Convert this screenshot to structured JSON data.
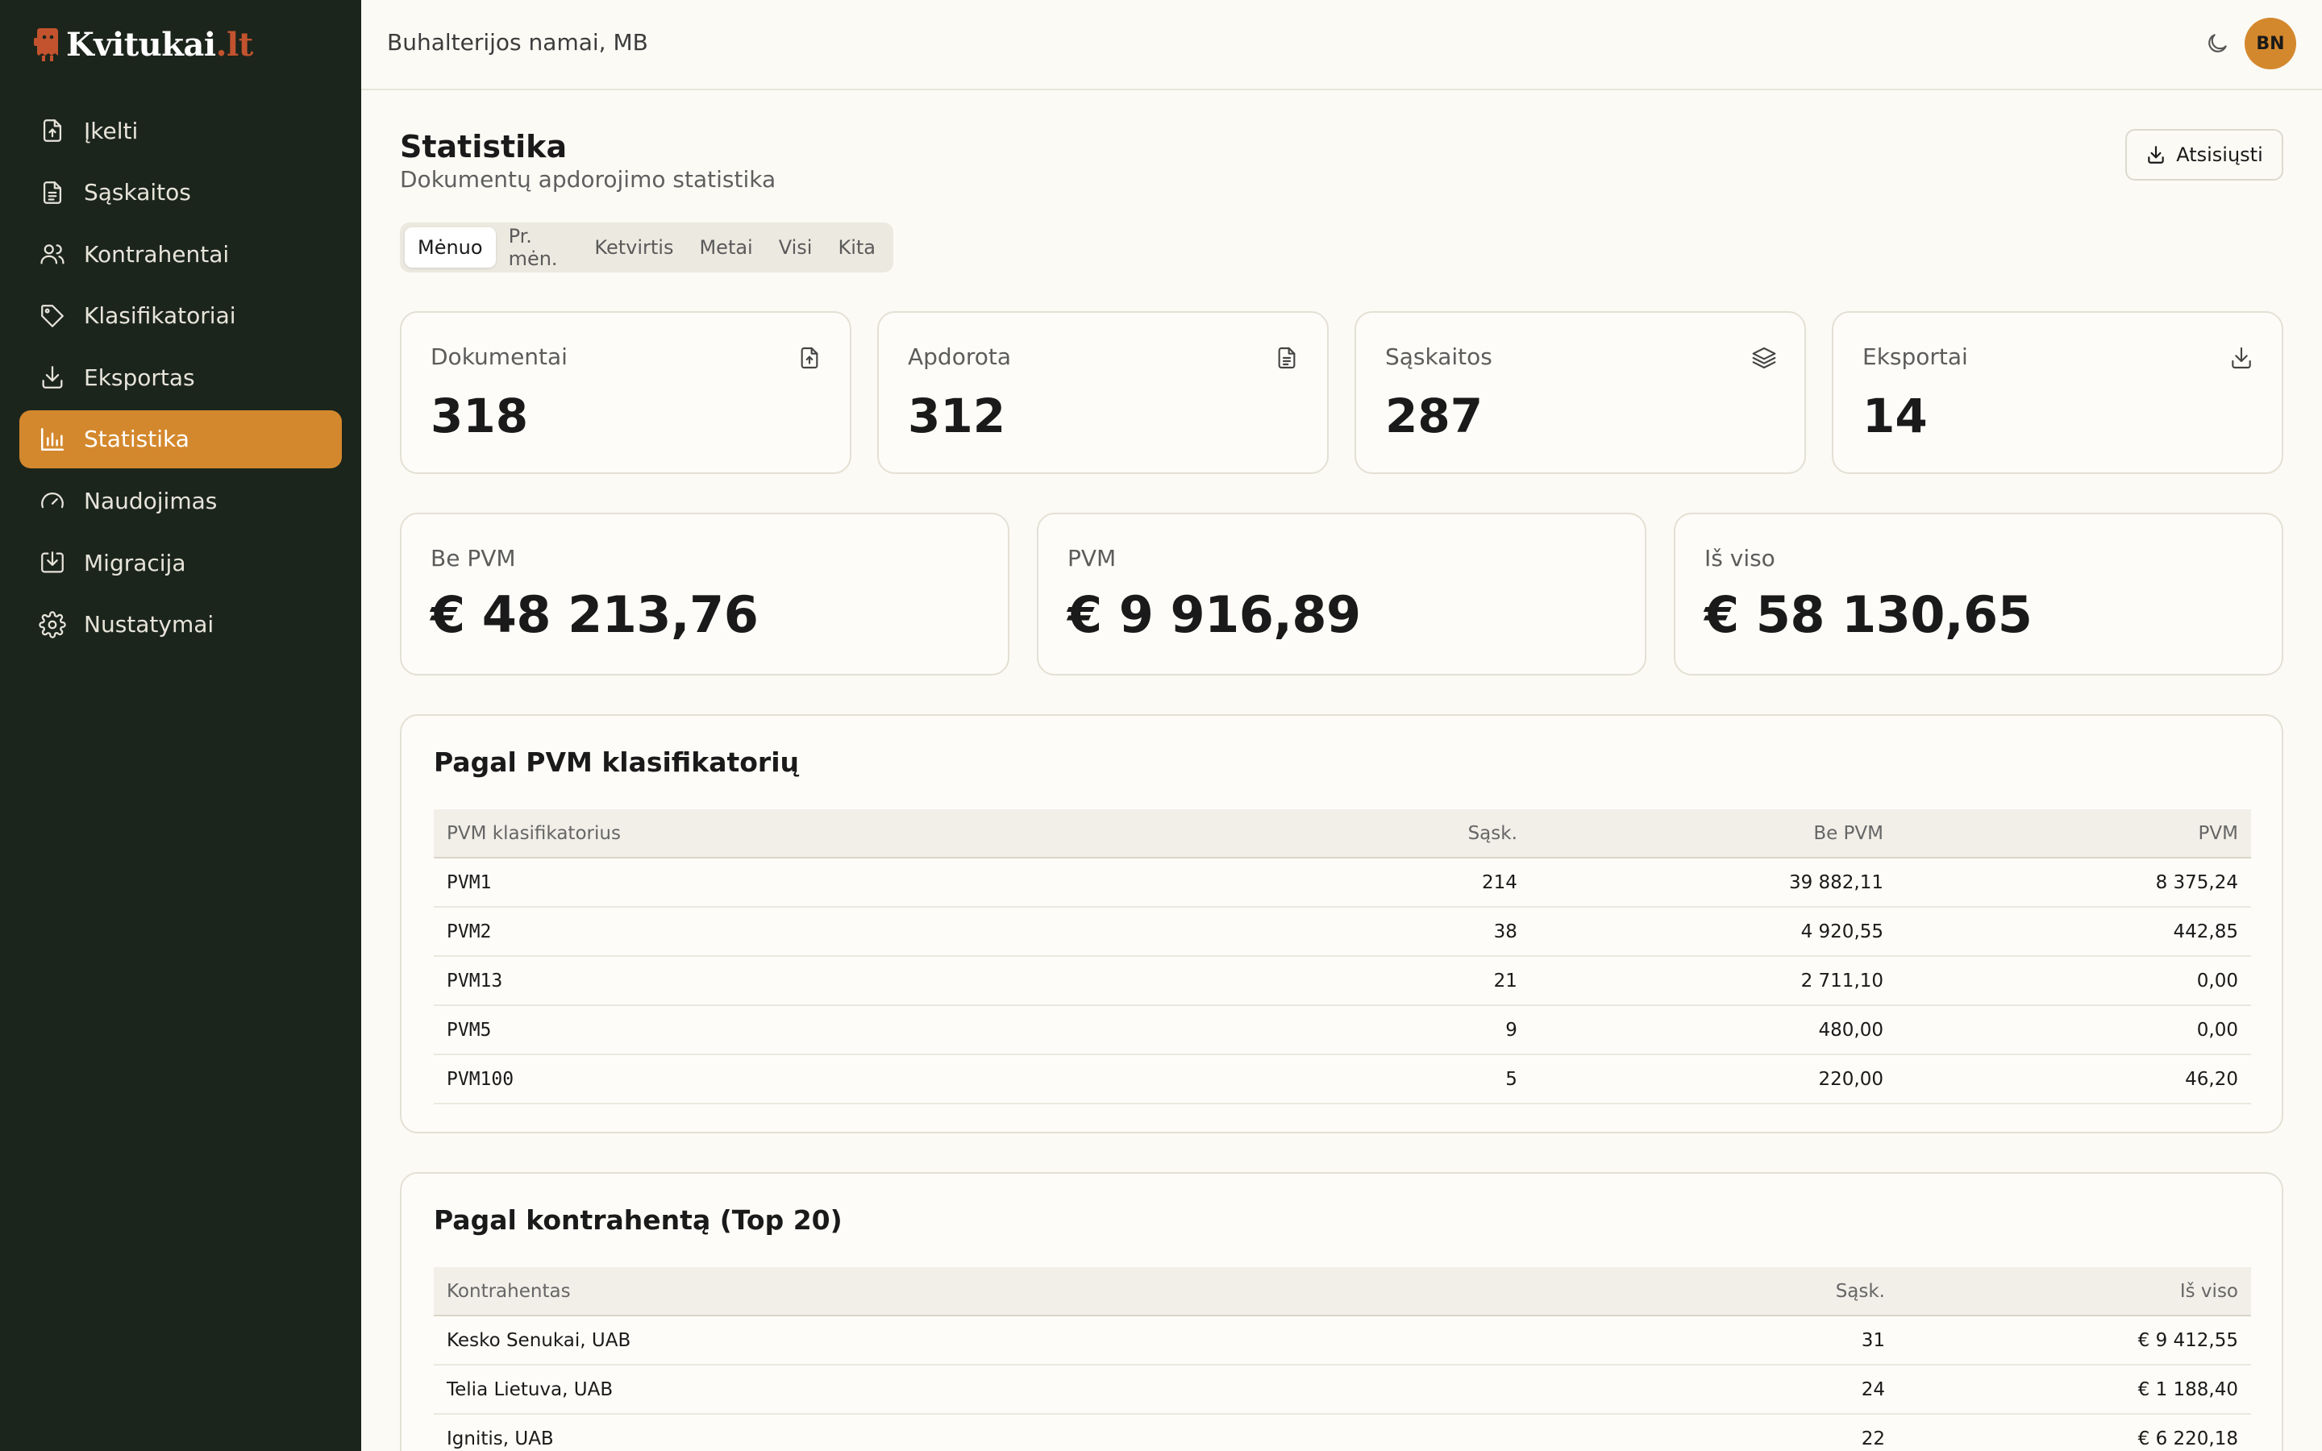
{
  "app": {
    "logo_text": "Kvitukai",
    "logo_tld": ".lt",
    "brand_color": "#d4882d",
    "logo_accent": "#c2532e"
  },
  "sidebar": {
    "items": [
      {
        "label": "Įkelti",
        "icon": "file-upload-icon"
      },
      {
        "label": "Sąskaitos",
        "icon": "file-text-icon"
      },
      {
        "label": "Kontrahentai",
        "icon": "users-icon"
      },
      {
        "label": "Klasifikatoriai",
        "icon": "tag-icon"
      },
      {
        "label": "Eksportas",
        "icon": "download-icon"
      },
      {
        "label": "Statistika",
        "icon": "bar-chart-icon",
        "active": true
      },
      {
        "label": "Naudojimas",
        "icon": "gauge-icon"
      },
      {
        "label": "Migracija",
        "icon": "import-icon"
      },
      {
        "label": "Nustatymai",
        "icon": "gear-icon"
      }
    ]
  },
  "header": {
    "company": "Buhalterijos namai, MB",
    "avatar_initials": "BN",
    "theme_icon": "moon-icon"
  },
  "page": {
    "title": "Statistika",
    "subtitle": "Dokumentų apdorojimo statistika",
    "download_label": "Atsisiųsti"
  },
  "tabs": [
    {
      "label": "Mėnuo",
      "active": true
    },
    {
      "label": "Pr. mėn."
    },
    {
      "label": "Ketvirtis"
    },
    {
      "label": "Metai"
    },
    {
      "label": "Visi"
    },
    {
      "label": "Kita"
    }
  ],
  "stats": [
    {
      "label": "Dokumentai",
      "value": "318",
      "icon": "file-upload-icon"
    },
    {
      "label": "Apdorota",
      "value": "312",
      "icon": "file-text-icon"
    },
    {
      "label": "Sąskaitos",
      "value": "287",
      "icon": "layers-icon"
    },
    {
      "label": "Eksportai",
      "value": "14",
      "icon": "download-icon"
    }
  ],
  "totals": [
    {
      "label": "Be PVM",
      "value": "€ 48 213,76"
    },
    {
      "label": "PVM",
      "value": "€ 9 916,89"
    },
    {
      "label": "Iš viso",
      "value": "€ 58 130,65"
    }
  ],
  "vat_table": {
    "title": "Pagal PVM klasifikatorių",
    "headers": [
      "PVM klasifikatorius",
      "Sąsk.",
      "Be PVM",
      "PVM"
    ],
    "rows": [
      [
        "PVM1",
        "214",
        "39 882,11",
        "8 375,24"
      ],
      [
        "PVM2",
        "38",
        "4 920,55",
        "442,85"
      ],
      [
        "PVM13",
        "21",
        "2 711,10",
        "0,00"
      ],
      [
        "PVM5",
        "9",
        "480,00",
        "0,00"
      ],
      [
        "PVM100",
        "5",
        "220,00",
        "46,20"
      ]
    ]
  },
  "partner_table": {
    "title": "Pagal kontrahentą (Top 20)",
    "headers": [
      "Kontrahentas",
      "Sąsk.",
      "Iš viso"
    ],
    "rows": [
      [
        "Kesko Senukai, UAB",
        "31",
        "€ 9 412,55"
      ],
      [
        "Telia Lietuva, UAB",
        "24",
        "€ 1 188,40"
      ],
      [
        "Ignitis, UAB",
        "22",
        "€ 6 220,18"
      ]
    ]
  }
}
